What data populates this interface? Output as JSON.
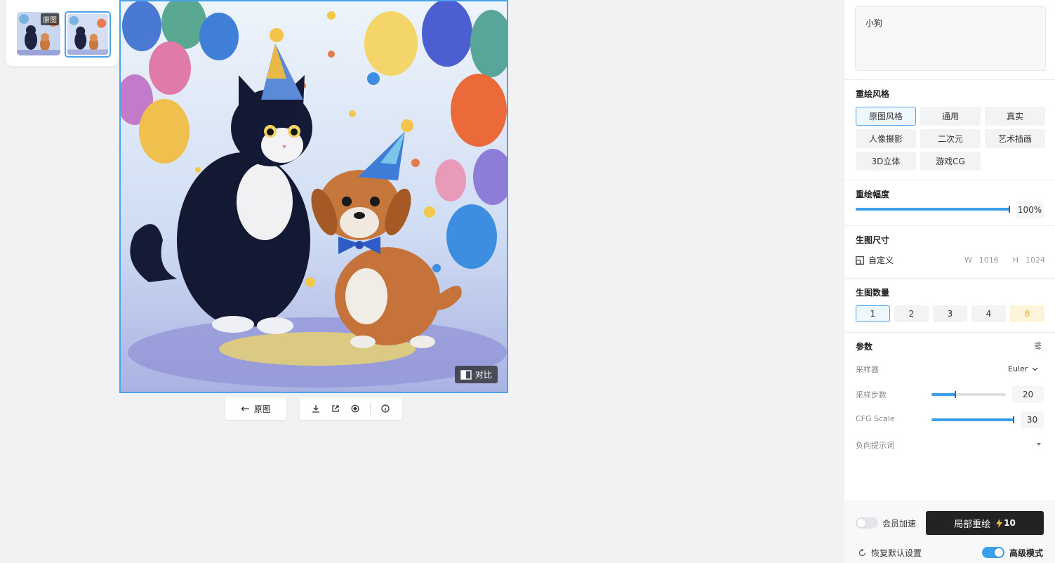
{
  "thumbnails": {
    "original_badge": "原图"
  },
  "image": {
    "compare_label": "对比"
  },
  "toolbar": {
    "back_label": "原图"
  },
  "panel": {
    "prompt_text": "小狗",
    "style_section_title": "重绘风格",
    "styles": [
      {
        "label": "原图风格",
        "active": true
      },
      {
        "label": "通用",
        "active": false
      },
      {
        "label": "真实",
        "active": false
      },
      {
        "label": "人像摄影",
        "active": false
      },
      {
        "label": "二次元",
        "active": false
      },
      {
        "label": "艺术插画",
        "active": false
      },
      {
        "label": "3D立体",
        "active": false
      },
      {
        "label": "游戏CG",
        "active": false
      }
    ],
    "strength_title": "重绘幅度",
    "strength_value": "100%",
    "strength_fraction": 1.0,
    "size_title": "生图尺寸",
    "size_mode": "自定义",
    "width_label": "W",
    "width_value": "1016",
    "height_label": "H",
    "height_value": "1024",
    "count_title": "生图数量",
    "counts": [
      "1",
      "2",
      "3",
      "4",
      "8"
    ],
    "params_title": "参数",
    "sampler_label": "采样器",
    "sampler_value": "Euler",
    "steps_label": "采样步数",
    "steps_value": "20",
    "steps_fraction": 0.33,
    "cfg_label": "CFG Scale",
    "cfg_value": "30",
    "cfg_fraction": 1.0,
    "negative_label": "负向提示词",
    "vip_label": "会员加速",
    "generate_label": "局部重绘",
    "generate_cost": "10",
    "reset_label": "恢复默认设置",
    "advanced_label": "高级模式"
  },
  "colors": {
    "accent": "#3e9ee8",
    "button_dark": "#232323",
    "gold": "#e0b14a"
  }
}
